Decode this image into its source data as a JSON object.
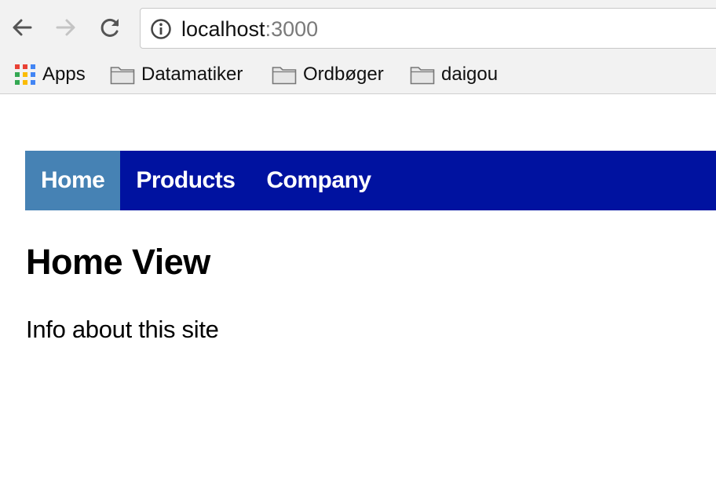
{
  "browser": {
    "url_host": "localhost",
    "url_port": ":3000",
    "bookmarks": [
      {
        "label": "Apps",
        "icon": "apps-grid-icon"
      },
      {
        "label": "Datamatiker",
        "icon": "folder-icon"
      },
      {
        "label": "Ordbøger",
        "icon": "folder-icon"
      },
      {
        "label": "daigou",
        "icon": "folder-icon"
      }
    ],
    "icons": {
      "back": "back-arrow-icon",
      "forward": "forward-arrow-icon",
      "reload": "reload-icon",
      "info": "info-icon"
    }
  },
  "menu": {
    "items": [
      {
        "label": "Home",
        "active": true
      },
      {
        "label": "Products",
        "active": false
      },
      {
        "label": "Company",
        "active": false
      }
    ],
    "colors": {
      "bar": "#0012a0",
      "active": "#4682b4",
      "text": "#ffffff"
    }
  },
  "page": {
    "title": "Home View",
    "text": "Info about this site"
  }
}
